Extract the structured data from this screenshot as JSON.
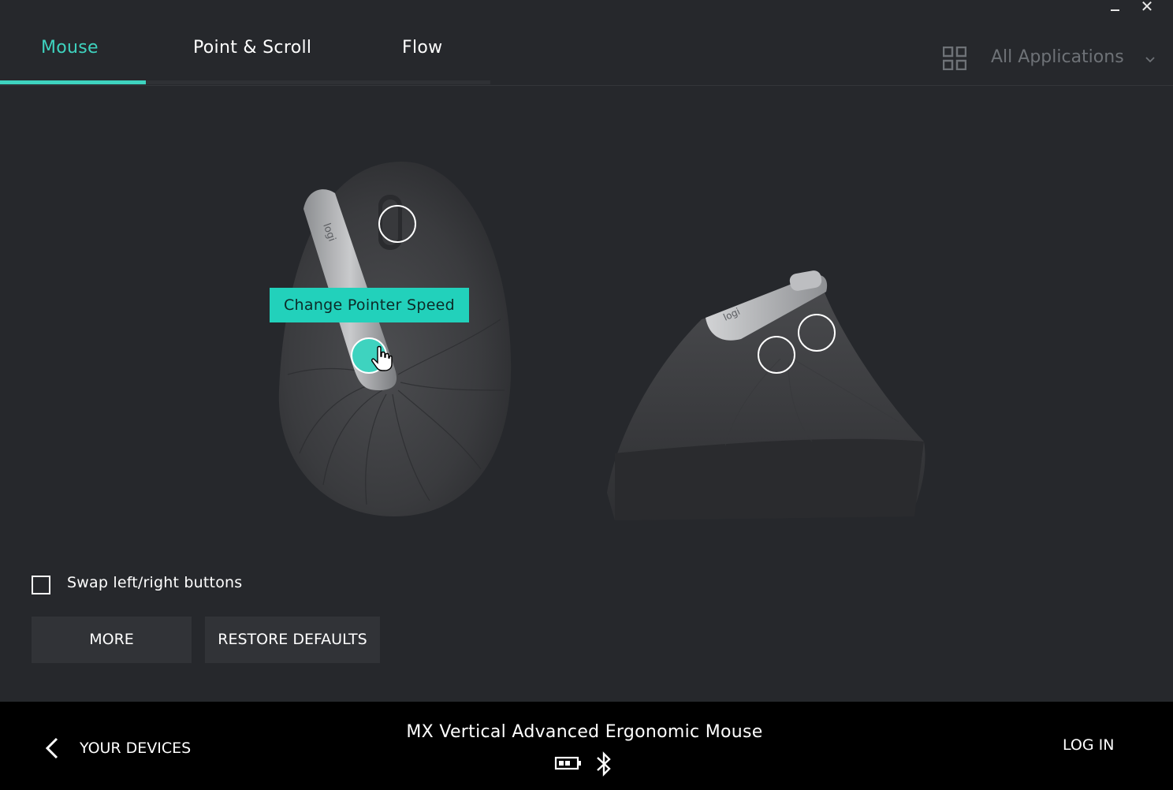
{
  "window": {
    "minimize_icon": "minimize-icon",
    "close_icon": "close-icon",
    "close_glyph": "✕"
  },
  "tabs": [
    {
      "label": "Mouse",
      "active": true
    },
    {
      "label": "Point & Scroll",
      "active": false
    },
    {
      "label": "Flow",
      "active": false
    }
  ],
  "app_selector": {
    "icon": "grid-icon",
    "label": "All Applications",
    "chevron": "chevron-down-icon"
  },
  "device_view": {
    "tooltip": "Change Pointer Speed",
    "hotspots": [
      "front-top-button",
      "front-pointer-speed-button",
      "side-back-button",
      "side-forward-button"
    ]
  },
  "options": {
    "swap_buttons_label": "Swap left/right buttons",
    "swap_buttons_checked": false,
    "more_label": "MORE",
    "restore_label": "RESTORE DEFAULTS"
  },
  "footer": {
    "back_label": "YOUR DEVICES",
    "device_name": "MX Vertical Advanced Ergonomic Mouse",
    "battery_icon": "battery-icon",
    "connection_icon": "bluetooth-icon",
    "login_label": "LOG IN"
  },
  "colors": {
    "accent": "#3ed3bf",
    "background": "#26282c",
    "footer": "#000000"
  }
}
